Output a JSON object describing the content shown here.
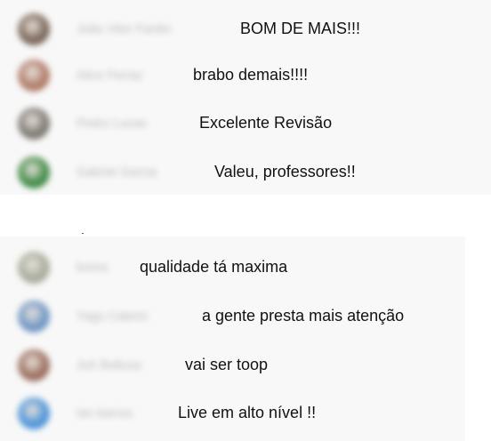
{
  "chat_groups": [
    {
      "messages": [
        {
          "author": "João Vitor Fardin",
          "text": "BOM DE MAIS!!!",
          "avatar_color": "#7a6658"
        },
        {
          "author": "Alice Ferraz",
          "text": "brabo demais!!!!",
          "avatar_color": "#b07a68"
        },
        {
          "author": "Pedro Lucas",
          "text": "Excelente Revisão",
          "avatar_color": "#7c7872"
        },
        {
          "author": "Gabriel Garcia",
          "text": "Valeu, professores!!",
          "avatar_color": "#3f8a45"
        }
      ]
    },
    {
      "messages": [
        {
          "author": "breno",
          "text": "qualidade tá maxima",
          "avatar_color": "#a7ab9a"
        },
        {
          "author": "Yago Cabrini",
          "text": "a gente presta mais atenção",
          "avatar_color": "#6f96c4"
        },
        {
          "author": "Juh Bellusa",
          "text": "vai ser toop",
          "avatar_color": "#9a6e5e"
        },
        {
          "author": "Ian barros",
          "text": "Live em alto nível !!",
          "avatar_color": "#4c93d8"
        }
      ]
    }
  ]
}
